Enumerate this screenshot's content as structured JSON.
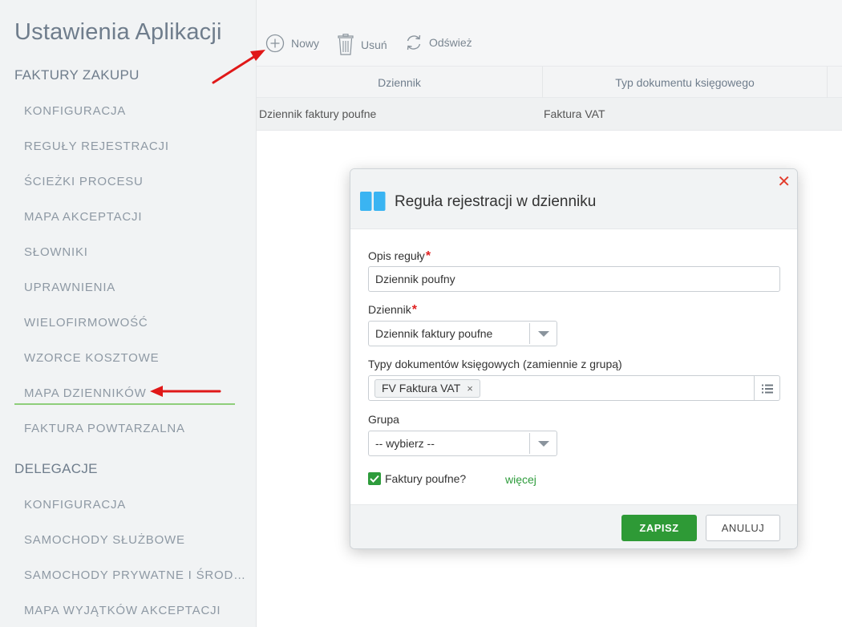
{
  "app_title": "Ustawienia Aplikacji",
  "sidebar": {
    "sections": [
      {
        "title": "FAKTURY ZAKUPU"
      },
      {
        "title": "DELEGACJE"
      }
    ],
    "purchase_items": [
      {
        "label": "KONFIGURACJA"
      },
      {
        "label": "REGUŁY REJESTRACJI"
      },
      {
        "label": "ŚCIEŻKI PROCESU"
      },
      {
        "label": "MAPA AKCEPTACJI"
      },
      {
        "label": "SŁOWNIKI"
      },
      {
        "label": "UPRAWNIENIA"
      },
      {
        "label": "WIELOFIRMOWOŚĆ"
      },
      {
        "label": "WZORCE KOSZTOWE"
      },
      {
        "label": "MAPA DZIENNIKÓW",
        "active": true
      },
      {
        "label": "FAKTURA POWTARZALNA"
      }
    ],
    "delegation_items": [
      {
        "label": "KONFIGURACJA"
      },
      {
        "label": "SAMOCHODY SŁUŻBOWE"
      },
      {
        "label": "SAMOCHODY PRYWATNE I ŚROD…"
      },
      {
        "label": "MAPA WYJĄTKÓW AKCEPTACJI"
      }
    ]
  },
  "toolbar": {
    "new_label": "Nowy",
    "delete_label": "Usuń",
    "refresh_label": "Odśwież",
    "icons": {
      "new": "plus-circle-icon",
      "delete": "trash-icon",
      "refresh": "refresh-icon"
    }
  },
  "grid": {
    "columns": [
      "Dziennik",
      "Typ dokumentu księgowego"
    ],
    "rows": [
      [
        "Dziennik faktury poufne",
        "Faktura VAT"
      ]
    ]
  },
  "modal": {
    "title": "Reguła rejestracji w dzienniku",
    "icon": "book-icon",
    "close_icon": "close-icon",
    "rule_desc_label": "Opis reguły",
    "rule_desc_value": "Dziennik poufny",
    "journal_label": "Dziennik",
    "journal_value": "Dziennik faktury poufne",
    "doc_types_label": "Typy dokumentów księgowych (zamiennie z grupą)",
    "doc_type_tag": "FV Faktura VAT",
    "group_label": "Grupa",
    "group_value": "-- wybierz --",
    "confidential_label": "Faktury poufne?",
    "confidential_checked": true,
    "more_link": "więcej",
    "save_label": "ZAPISZ",
    "cancel_label": "ANULUJ"
  },
  "colors": {
    "accent_green": "#2e9a36",
    "annotation_red": "#e01818",
    "close_red": "#e23c2c",
    "book_icon_blue": "#3ab4f2"
  }
}
